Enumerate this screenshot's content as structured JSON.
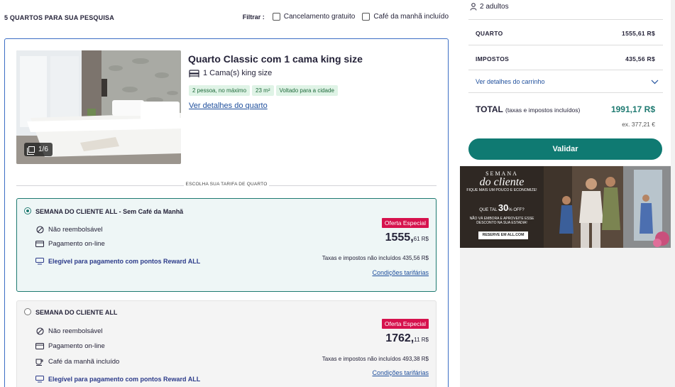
{
  "results": {
    "count_label": "5 QUARTOS PARA SUA PESQUISA",
    "filter_label": "Filtrar :",
    "filter_options": [
      "Cancelamento gratuito",
      "Café da manhã incluído"
    ]
  },
  "room": {
    "photo_counter": "1/6",
    "title": "Quarto Classic com 1 cama king size",
    "bed": "1 Cama(s) king size",
    "tags": [
      "2 pessoa, no máximo",
      "23 m²",
      "Voltado para a cidade"
    ],
    "details_link": "Ver detalhes do quarto",
    "choose_rate_label": "ESCOLHA SUA TARIFA DE QUARTO"
  },
  "rates": [
    {
      "title": "SEMANA DO CLIENTE ALL - Sem Café da Manhã",
      "selected": true,
      "features": [
        "Não reembolsável",
        "Pagamento on-line"
      ],
      "reward": "Elegível para pagamento com pontos Reward ALL",
      "offer_badge": "Oferta Especial",
      "price_int": "1555,",
      "price_dec": "61 R$",
      "tax_note": "Taxas e impostos não incluídos 435,56 R$",
      "conditions_link": "Condições tarifárias"
    },
    {
      "title": "SEMANA DO CLIENTE ALL",
      "selected": false,
      "features": [
        "Não reembolsável",
        "Pagamento on-line",
        "Café da manhã incluído"
      ],
      "reward": "Elegível para pagamento com pontos Reward ALL",
      "offer_badge": "Oferta Especial",
      "price_int": "1762,",
      "price_dec": "11 R$",
      "tax_note": "Taxas e impostos não incluídos 493,38 R$",
      "conditions_link": "Condições tarifárias"
    }
  ],
  "cart": {
    "guests": "2 adultos",
    "room_label": "QUARTO",
    "room_value": "1555,61 R$",
    "tax_label": "IMPOSTOS",
    "tax_value": "435,56 R$",
    "details_link": "Ver detalhes do carrinho",
    "total_label": "TOTAL",
    "total_note": "(taxas e impostos incluídos)",
    "total_value": "1991,17 R$",
    "ex_value": "ex. 377,21 €",
    "validate_label": "Validar"
  },
  "banner": {
    "line1": "SEMANA",
    "line2": "do cliente",
    "line3": "FIQUE MAIS UM POUCO E ECONOMIZE!",
    "off_prefix": "QUE TAL",
    "off_value": "30",
    "off_suffix": "% OFF?",
    "line4": "NÃO VÁ EMBORA E APROVEITE ESSE DESCONTO NA SUA ESTADIA!",
    "cta": "RESERVE EM ALL.COM"
  },
  "colors": {
    "accent": "#0f7a72",
    "offer": "#d6124d",
    "link": "#1f4f9c",
    "card_border": "#3c6ec5"
  }
}
